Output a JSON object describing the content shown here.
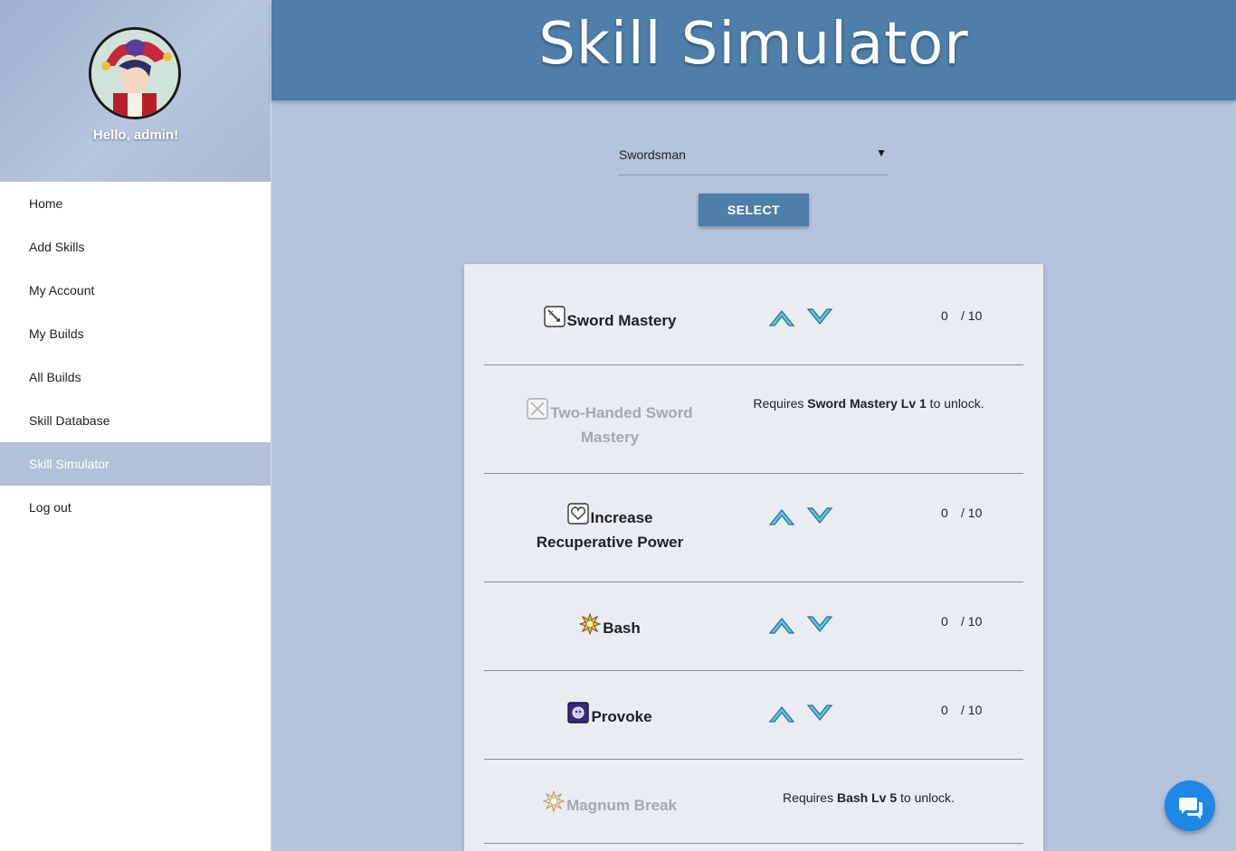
{
  "sidebar": {
    "greeting": "Hello, admin!",
    "nav": [
      {
        "label": "Home"
      },
      {
        "label": "Add Skills"
      },
      {
        "label": "My Account"
      },
      {
        "label": "My Builds"
      },
      {
        "label": "All Builds"
      },
      {
        "label": "Skill Database"
      },
      {
        "label": "Skill Simulator",
        "active": true
      },
      {
        "label": "Log out"
      }
    ]
  },
  "header": {
    "title": "Skill Simulator"
  },
  "class_select": {
    "value": "Swordsman",
    "button_label": "SELECT"
  },
  "skills": [
    {
      "name_line1": "Sword Mastery",
      "name_line2": "",
      "level": "0",
      "max": "/ 10",
      "icon": "sword-mastery-icon"
    },
    {
      "name_line1": "Two-Handed Sword",
      "name_line2": "Mastery",
      "locked": true,
      "req_prefix": "Requires ",
      "req_skill": "Sword Mastery Lv 1",
      "req_suffix": " to unlock.",
      "icon": "two-handed-sword-mastery-icon"
    },
    {
      "name_line1": "Increase",
      "name_line2": "Recuperative Power",
      "level": "0",
      "max": "/ 10",
      "icon": "increase-recuperative-power-icon"
    },
    {
      "name_line1": "Bash",
      "name_line2": "",
      "level": "0",
      "max": "/ 10",
      "icon": "bash-icon"
    },
    {
      "name_line1": "Provoke",
      "name_line2": "",
      "level": "0",
      "max": "/ 10",
      "icon": "provoke-icon"
    },
    {
      "name_line1": "Magnum Break",
      "name_line2": "",
      "locked": true,
      "req_prefix": "Requires ",
      "req_skill": "Bash Lv 5",
      "req_suffix": " to unlock.",
      "icon": "magnum-break-icon"
    }
  ],
  "colors": {
    "header": "#4e7eaa",
    "background": "#b5c3dc",
    "active_nav": "#b2c0da",
    "arrow": "#5fc3e8",
    "chat_fab": "#1e88e5"
  }
}
